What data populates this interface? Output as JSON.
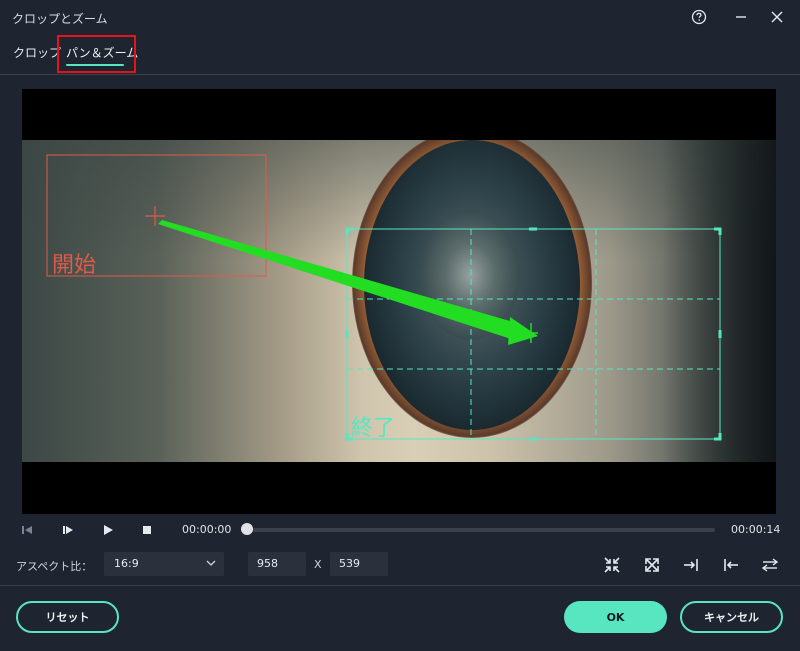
{
  "window": {
    "title": "クロップとズーム"
  },
  "tabs": [
    {
      "label": "クロップ",
      "active": false
    },
    {
      "label": "パン＆ズーム",
      "active": true
    }
  ],
  "preview": {
    "start_label": "開始",
    "end_label": "終了",
    "start_color": "#e05a4a",
    "end_color": "#58e6c1",
    "arrow_color": "#22dd22"
  },
  "player": {
    "current_time": "00:00:00",
    "end_time": "00:00:14",
    "progress": 0.0
  },
  "aspect": {
    "label": "アスペクト比：",
    "selected": "16:9",
    "width": "958",
    "height": "539",
    "separator": "X"
  },
  "buttons": {
    "reset": "リセット",
    "ok": "OK",
    "cancel": "キャンセル"
  },
  "colors": {
    "accent": "#58e6c1",
    "background": "#1f2530",
    "highlight_box": "#e4141b"
  }
}
